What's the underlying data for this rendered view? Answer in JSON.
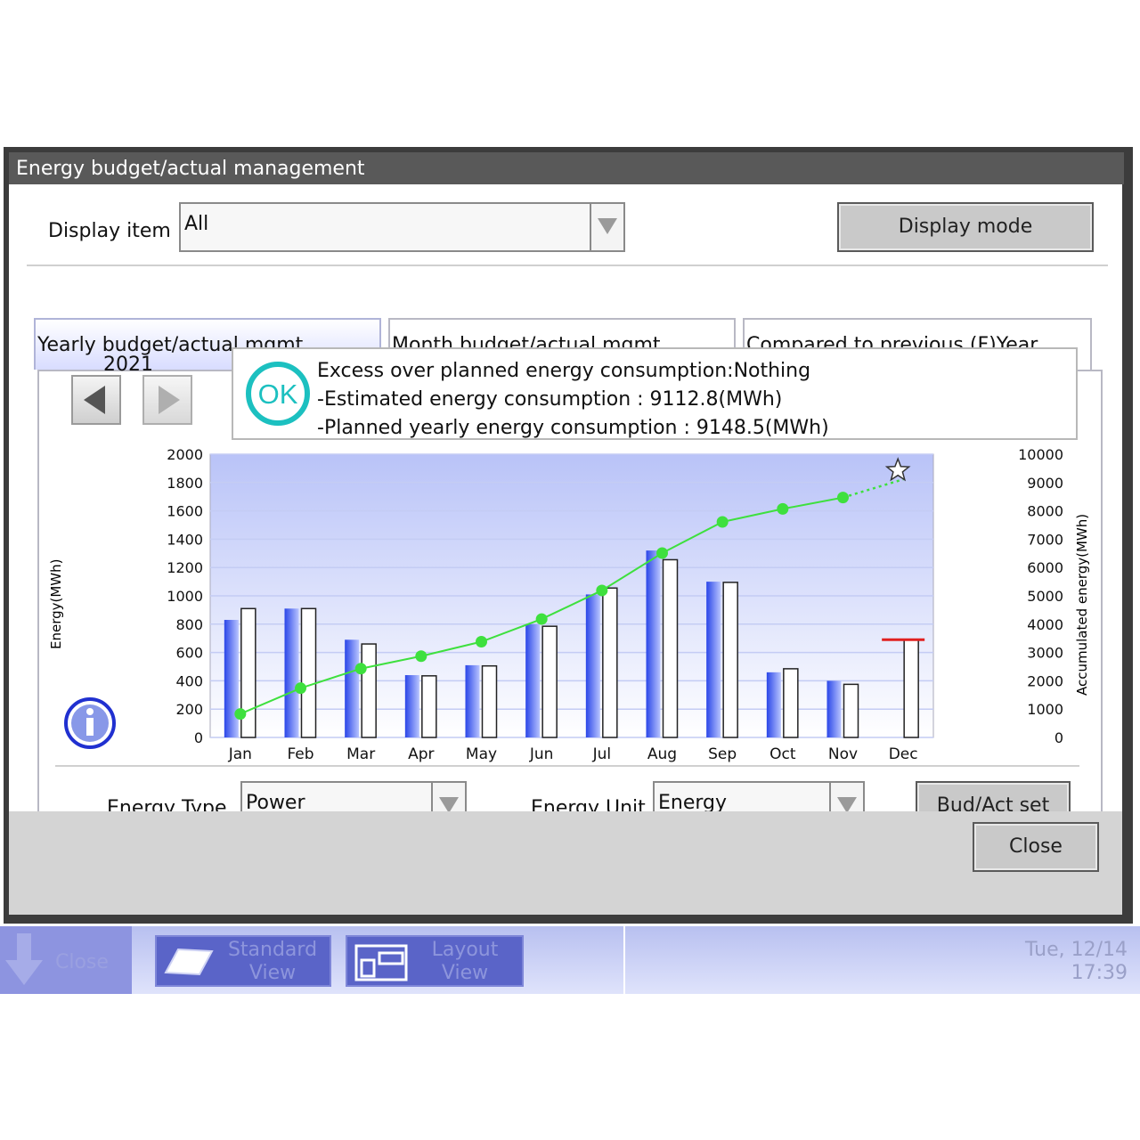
{
  "window": {
    "title": "Energy budget/actual management"
  },
  "display_item": {
    "label": "Display item",
    "value": "All"
  },
  "display_mode_button": "Display mode",
  "tabs": [
    {
      "label": "Yearly budget/actual mgmt.",
      "active": true
    },
    {
      "label": "Month budget/actual mgmt.",
      "active": false
    },
    {
      "label": "Compared to previous (F)Year",
      "active": false
    }
  ],
  "year": "2021",
  "status": {
    "badge": "OK",
    "line1": "Excess over planned energy consumption:Nothing",
    "line2": "-Estimated energy consumption : 9112.8(MWh)",
    "line3": "-Planned yearly energy consumption : 9148.5(MWh)"
  },
  "chart_data": {
    "type": "bar",
    "categories": [
      "Jan",
      "Feb",
      "Mar",
      "Apr",
      "May",
      "Jun",
      "Jul",
      "Aug",
      "Sep",
      "Oct",
      "Nov",
      "Dec"
    ],
    "ylabel": "Energy(MWh)",
    "y2label": "Accumulated energy(MWh)",
    "ylim": [
      0,
      2000
    ],
    "y2lim": [
      0,
      10000
    ],
    "yticks": [
      "2000",
      "1800",
      "1600",
      "1400",
      "1200",
      "1000",
      "800",
      "600",
      "400",
      "200",
      "0"
    ],
    "y2ticks": [
      "10000",
      "9000",
      "8000",
      "7000",
      "6000",
      "5000",
      "4000",
      "3000",
      "2000",
      "1000",
      "0"
    ],
    "series": [
      {
        "values": [
          830,
          910,
          690,
          440,
          510,
          800,
          1010,
          1320,
          1100,
          460,
          400,
          null
        ],
        "color": "#3a5cf0"
      },
      {
        "values": [
          910,
          910,
          660,
          435,
          505,
          785,
          1055,
          1255,
          1095,
          485,
          375,
          690
        ],
        "color": "#ffffff"
      }
    ],
    "accumulated": [
      830,
      1740,
      2430,
      2870,
      3380,
      4180,
      5190,
      6510,
      7610,
      8070,
      8470,
      9112.8
    ],
    "dec_marker_value": 690,
    "line_color": "#3ee03e",
    "marker_color": "#e02020",
    "grid": true
  },
  "energy_type": {
    "label": "Energy Type",
    "value": "Power"
  },
  "energy_unit": {
    "label": "Energy Unit",
    "value": "Energy"
  },
  "budact_button": "Bud/Act set",
  "close_button": "Close",
  "taskbar": {
    "close_label": "Close",
    "standard_view": [
      "Standard",
      "View"
    ],
    "layout_view": [
      "Layout",
      "View"
    ],
    "date": "Tue, 12/14",
    "time": "17:39"
  }
}
